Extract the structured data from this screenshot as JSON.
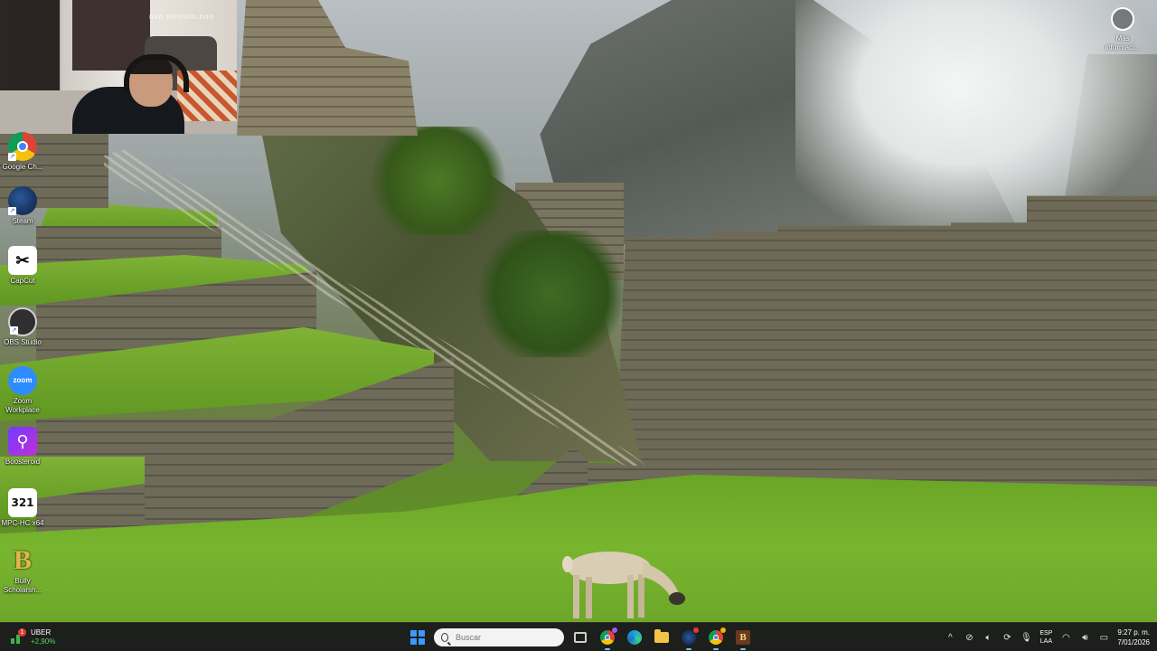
{
  "webcam": {
    "watermark": "nnn.nnnnnn.nnn"
  },
  "desktop": {
    "icons": [
      {
        "label": "Google Ch...",
        "icon": "chrome-icon"
      },
      {
        "label": "Steam",
        "icon": "steam-icon"
      },
      {
        "label": "CapCut",
        "icon": "capcut-icon",
        "glyph": "✂"
      },
      {
        "label": "OBS Studio",
        "icon": "obs-icon"
      },
      {
        "label": "Zoom Workplace",
        "icon": "zoom-icon",
        "glyph": "zoom"
      },
      {
        "label": "Boosteroid",
        "icon": "boosteroid-icon",
        "glyph": "⚲"
      },
      {
        "label": "MPC-HC x64",
        "icon": "mpc-icon",
        "glyph": "321"
      },
      {
        "label": "Bully Scholarsh...",
        "icon": "bully-icon",
        "glyph": "B"
      }
    ],
    "spotlight": {
      "label": "Más informaci...",
      "icon": "camera-icon"
    }
  },
  "taskbar": {
    "stock": {
      "name": "UBER",
      "change": "+2,90%",
      "badge": "1",
      "color": "#3bb54a"
    },
    "search": {
      "placeholder": "Buscar"
    },
    "apps": [
      "start-icon",
      "task-view-icon",
      "chrome-icon",
      "edge-icon",
      "file-explorer-icon",
      "steam-icon",
      "chrome-icon",
      "bully-icon"
    ],
    "tray": {
      "chevron": "^",
      "language": {
        "line1": "ESP",
        "line2": "LAA"
      }
    },
    "clock": {
      "time": "9:27 p. m.",
      "date": "7/01/2026"
    }
  },
  "colors": {
    "accent": "#3a9bff",
    "taskbar": "#1c1f1c"
  }
}
